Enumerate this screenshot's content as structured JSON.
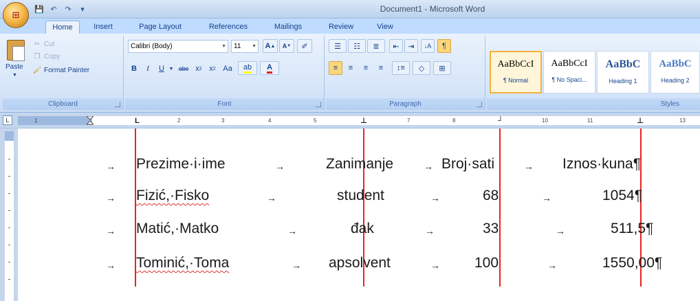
{
  "window": {
    "title": "Document1 - Microsoft Word"
  },
  "office_button": {
    "label": "Office"
  },
  "quick_access": {
    "save_glyph": "💾",
    "undo_glyph": "↶",
    "redo_glyph": "↷",
    "more_glyph": "▾"
  },
  "tabs": [
    "Home",
    "Insert",
    "Page Layout",
    "References",
    "Mailings",
    "Review",
    "View"
  ],
  "clipboard": {
    "paste": "Paste",
    "cut": "Cut",
    "copy": "Copy",
    "format_painter": "Format Painter",
    "group": "Clipboard"
  },
  "font": {
    "name": "Calibri (Body)",
    "size": "11",
    "group": "Font"
  },
  "paragraph": {
    "group": "Paragraph"
  },
  "styles": {
    "group": "Styles",
    "items": [
      {
        "preview": "AaBbCcI",
        "name": "¶ Normal"
      },
      {
        "preview": "AaBbCcI",
        "name": "¶ No Spaci..."
      },
      {
        "preview": "AaBbC",
        "name": "Heading 1"
      },
      {
        "preview": "AaBbC",
        "name": "Heading 2"
      }
    ]
  },
  "ruler": {
    "numbers": [
      "1",
      "1",
      "2",
      "3",
      "4",
      "5",
      "6",
      "7",
      "8",
      "9",
      "10",
      "11",
      "12",
      "13"
    ]
  },
  "document": {
    "tab_arrow": "→",
    "rows": [
      {
        "c1": "Prezime·i·ime",
        "c2": "Zanimanje",
        "c3": "Broj·sati",
        "c4": "Iznos·kuna¶"
      },
      {
        "c1": "Fizić,·Fisko",
        "c2": "student",
        "c3": "68",
        "c4": "1054¶"
      },
      {
        "c1": "Matić,·Matko",
        "c2": "đak",
        "c3": "33",
        "c4": "511,5¶"
      },
      {
        "c1": "Tominić,·Toma",
        "c2": "apsolvent",
        "c3": "100",
        "c4": "1550,00¶"
      }
    ]
  }
}
